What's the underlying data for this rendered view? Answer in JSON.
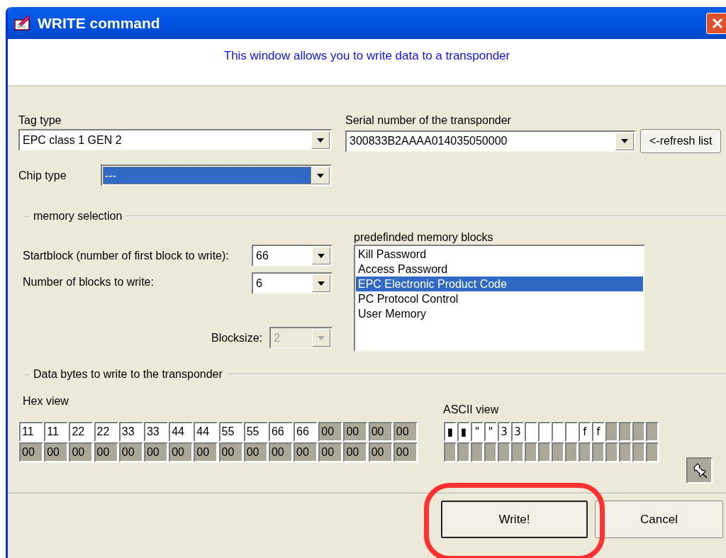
{
  "window": {
    "title": "WRITE command"
  },
  "header": {
    "message": "This window allows you to write data to a transponder"
  },
  "tag_type": {
    "label": "Tag type",
    "value": "EPC class 1 GEN 2"
  },
  "serial_number": {
    "label": "Serial number of the transponder",
    "value": "300833B2AAAA014035050000"
  },
  "refresh_button": {
    "label": "<-refresh list"
  },
  "chip_type": {
    "label": "Chip type",
    "value": "---",
    "focused": true
  },
  "memory_selection": {
    "title": "memory selection",
    "startblock": {
      "label": "Startblock (number of first block to write):",
      "value": "66"
    },
    "block_count": {
      "label": "Number of blocks to write:",
      "value": "6"
    },
    "blocksize": {
      "label": "Blocksize:",
      "value": "2",
      "disabled": true
    },
    "predefined_blocks": {
      "label": "predefinded memory blocks",
      "items": [
        {
          "label": "Kill Password",
          "selected": false
        },
        {
          "label": "Access Password",
          "selected": false
        },
        {
          "label": "EPC Electronic Product Code",
          "selected": true
        },
        {
          "label": "PC Protocol Control",
          "selected": false
        },
        {
          "label": "User Memory",
          "selected": false
        }
      ]
    }
  },
  "data_bytes": {
    "title": "Data bytes to write to the transponder",
    "hex_view": {
      "label": "Hex view",
      "cells": [
        {
          "value": "11",
          "active": true
        },
        {
          "value": "11",
          "active": true
        },
        {
          "value": "22",
          "active": true
        },
        {
          "value": "22",
          "active": true
        },
        {
          "value": "33",
          "active": true
        },
        {
          "value": "33",
          "active": true
        },
        {
          "value": "44",
          "active": true
        },
        {
          "value": "44",
          "active": true
        },
        {
          "value": "55",
          "active": true
        },
        {
          "value": "55",
          "active": true
        },
        {
          "value": "66",
          "active": true
        },
        {
          "value": "66",
          "active": true
        },
        {
          "value": "00",
          "active": false
        },
        {
          "value": "00",
          "active": false
        },
        {
          "value": "00",
          "active": false
        },
        {
          "value": "00",
          "active": false
        },
        {
          "value": "00",
          "active": false
        },
        {
          "value": "00",
          "active": false
        },
        {
          "value": "00",
          "active": false
        },
        {
          "value": "00",
          "active": false
        },
        {
          "value": "00",
          "active": false
        },
        {
          "value": "00",
          "active": false
        },
        {
          "value": "00",
          "active": false
        },
        {
          "value": "00",
          "active": false
        },
        {
          "value": "00",
          "active": false
        },
        {
          "value": "00",
          "active": false
        },
        {
          "value": "00",
          "active": false
        },
        {
          "value": "00",
          "active": false
        },
        {
          "value": "00",
          "active": false
        },
        {
          "value": "00",
          "active": false
        },
        {
          "value": "00",
          "active": false
        },
        {
          "value": "00",
          "active": false
        }
      ]
    },
    "ascii_view": {
      "label": "ASCII view",
      "cells": [
        {
          "char": "▮",
          "active": true
        },
        {
          "char": "▮",
          "active": true
        },
        {
          "char": "\"",
          "active": true
        },
        {
          "char": "\"",
          "active": true
        },
        {
          "char": "3",
          "active": true
        },
        {
          "char": "3",
          "active": true
        },
        {
          "active": true
        },
        {
          "active": true
        },
        {
          "active": true
        },
        {
          "active": true
        },
        {
          "char": "f",
          "active": true
        },
        {
          "char": "f",
          "active": true
        },
        {
          "active": false
        },
        {
          "active": false
        },
        {
          "active": false
        },
        {
          "active": false
        },
        {
          "active": false
        },
        {
          "active": false
        },
        {
          "active": false
        },
        {
          "active": false
        },
        {
          "active": false
        },
        {
          "active": false
        },
        {
          "active": false
        },
        {
          "active": false
        },
        {
          "active": false
        },
        {
          "active": false
        },
        {
          "active": false
        },
        {
          "active": false
        },
        {
          "active": false
        },
        {
          "active": false
        },
        {
          "active": false
        },
        {
          "active": false
        }
      ]
    }
  },
  "write_button": {
    "label": "Write!",
    "highlighted": true
  },
  "cancel_button": {
    "label": "Cancel"
  }
}
